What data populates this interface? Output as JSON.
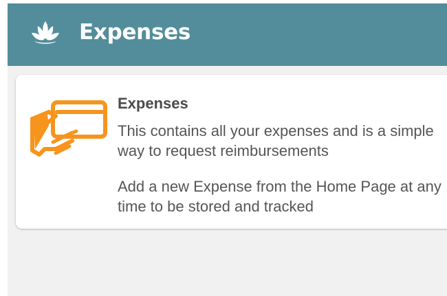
{
  "app_bar": {
    "title": "Expenses",
    "logo_icon": "lotus-icon",
    "background": "#538d9b"
  },
  "info_card": {
    "icon": "card-in-hand-icon",
    "icon_color": "#f7941d",
    "title": "Expenses",
    "description": "This contains all your expenses and is a simple way to request reimbursements",
    "hint": "Add a new Expense from the Home Page at any time to be stored and tracked"
  }
}
